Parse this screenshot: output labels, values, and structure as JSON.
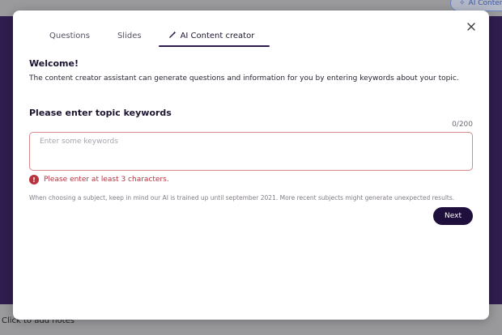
{
  "background": {
    "top_pill_label": "AI Content",
    "notes_placeholder": "Click to add notes"
  },
  "modal": {
    "tabs": [
      {
        "label": "Questions",
        "active": false
      },
      {
        "label": "Slides",
        "active": false
      },
      {
        "label": "AI Content creator",
        "active": true,
        "icon": "magic-wand-icon"
      }
    ],
    "close_icon": "close-icon",
    "welcome_title": "Welcome!",
    "welcome_text": "The content creator assistant can generate questions and information for you by entering keywords about your topic.",
    "keywords_title": "Please enter topic keywords",
    "char_counter": "0/200",
    "keywords_value": "",
    "keywords_placeholder": "Enter some keywords",
    "error_message": "Please enter at least 3 characters.",
    "disclaimer": "When choosing a subject, keep in mind our AI is trained up until september 2021. More recent subjects might generate unexpected results.",
    "next_label": "Next"
  },
  "colors": {
    "accent": "#1f0f3d",
    "error": "#b9333f",
    "input_error_border": "#d9878d"
  }
}
